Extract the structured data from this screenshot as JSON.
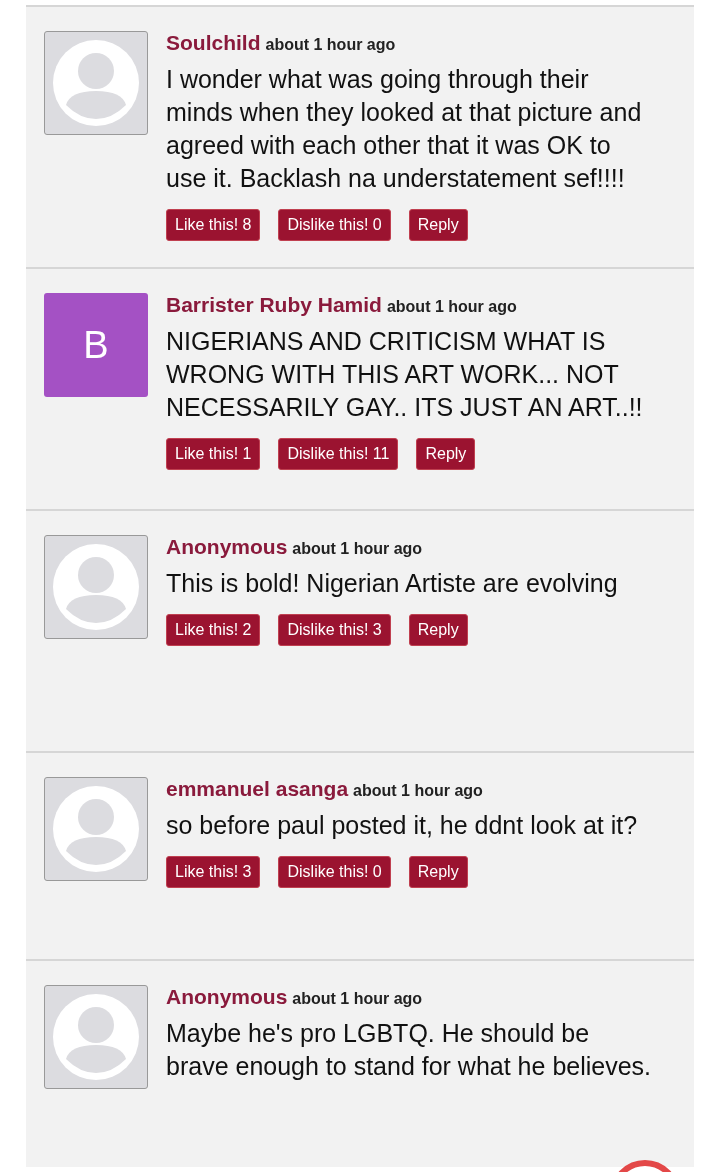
{
  "comments": [
    {
      "avatar": {
        "kind": "placeholder"
      },
      "author": "Soulchild",
      "time": "about 1 hour ago",
      "text": "I wonder what was going through their minds when they looked at that picture and agreed with each other that it was OK to use it. Backlash na understatement sef!!!!",
      "actions": [
        "Like this! 8",
        "Dislike this! 0",
        "Reply"
      ]
    },
    {
      "avatar": {
        "kind": "letter",
        "letter": "B",
        "color": "#a451c4"
      },
      "author": "Barrister Ruby Hamid",
      "time": "about 1 hour ago",
      "text": "NIGERIANS AND CRITICISM WHAT IS WRONG WITH THIS ART WORK... NOT NECESSARILY GAY.. ITS JUST AN ART..!!",
      "actions": [
        "Like this! 1",
        "Dislike this! 11",
        "Reply"
      ]
    },
    {
      "avatar": {
        "kind": "placeholder"
      },
      "author": "Anonymous",
      "time": "about 1 hour ago",
      "text": "This is bold! Nigerian Artiste are evolving",
      "actions": [
        "Like this! 2",
        "Dislike this! 3",
        "Reply"
      ]
    },
    {
      "avatar": {
        "kind": "placeholder"
      },
      "author": "emmanuel asanga",
      "time": "about 1 hour ago",
      "text": "so before paul posted it, he ddnt look at it?",
      "actions": [
        "Like this! 3",
        "Dislike this! 0",
        "Reply"
      ]
    },
    {
      "avatar": {
        "kind": "placeholder"
      },
      "author": "Anonymous",
      "time": "about 1 hour ago",
      "text": "Maybe he's pro LGBTQ. He should be brave enough to stand for what he believes."
    }
  ]
}
